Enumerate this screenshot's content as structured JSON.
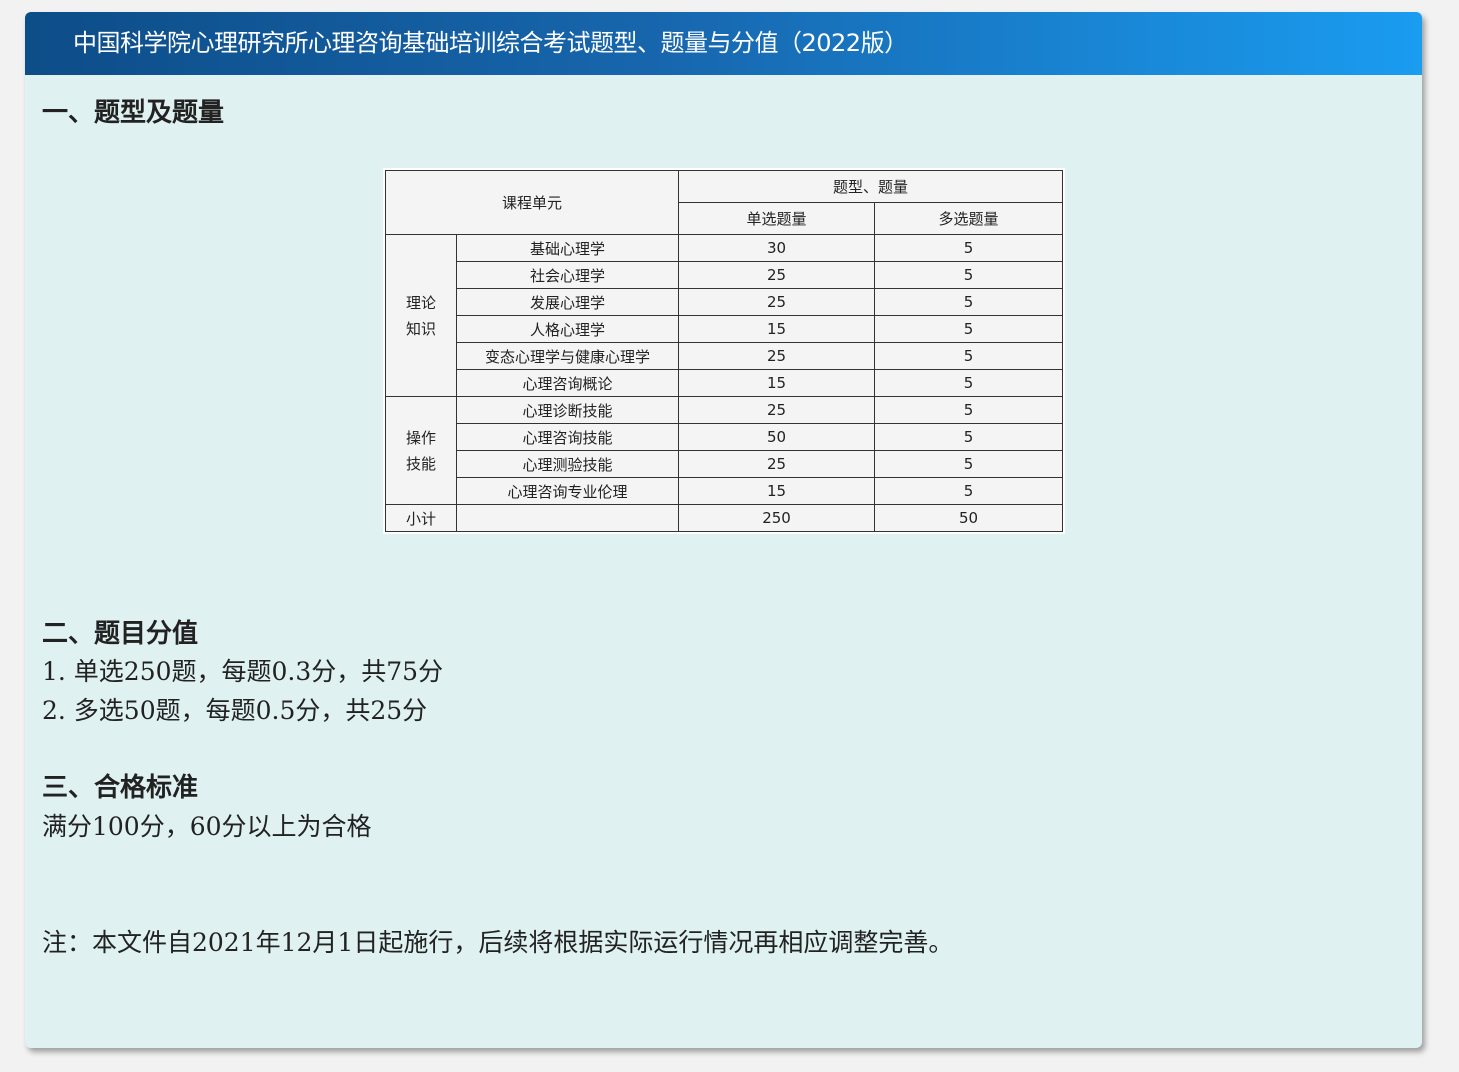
{
  "header": {
    "title": "中国科学院心理研究所心理咨询基础培训综合考试题型、题量与分值（2022版）"
  },
  "section1": {
    "title": "一、题型及题量"
  },
  "table": {
    "course_unit_header": "课程单元",
    "type_header": "题型、题量",
    "single_header": "单选题量",
    "multi_header": "多选题量",
    "groups": [
      {
        "name_line1": "理论",
        "name_line2": "知识",
        "rows": [
          {
            "course": "基础心理学",
            "single": "30",
            "multi": "5"
          },
          {
            "course": "社会心理学",
            "single": "25",
            "multi": "5"
          },
          {
            "course": "发展心理学",
            "single": "25",
            "multi": "5"
          },
          {
            "course": "人格心理学",
            "single": "15",
            "multi": "5"
          },
          {
            "course": "变态心理学与健康心理学",
            "single": "25",
            "multi": "5"
          },
          {
            "course": "心理咨询概论",
            "single": "15",
            "multi": "5"
          }
        ]
      },
      {
        "name_line1": "操作",
        "name_line2": "技能",
        "rows": [
          {
            "course": "心理诊断技能",
            "single": "25",
            "multi": "5"
          },
          {
            "course": "心理咨询技能",
            "single": "50",
            "multi": "5"
          },
          {
            "course": "心理测验技能",
            "single": "25",
            "multi": "5"
          },
          {
            "course": "心理咨询专业伦理",
            "single": "15",
            "multi": "5"
          }
        ]
      }
    ],
    "subtotal": {
      "label": "小计",
      "single": "250",
      "multi": "50"
    }
  },
  "section2": {
    "title": "二、题目分值",
    "items": [
      "1.  单选250题，每题0.3分，共75分",
      "2.  多选50题，每题0.5分，共25分"
    ]
  },
  "section3": {
    "title": "三、合格标准",
    "text": "满分100分，60分以上为合格"
  },
  "note": {
    "text": "注：本文件自2021年12月1日起施行，后续将根据实际运行情况再相应调整完善。"
  }
}
